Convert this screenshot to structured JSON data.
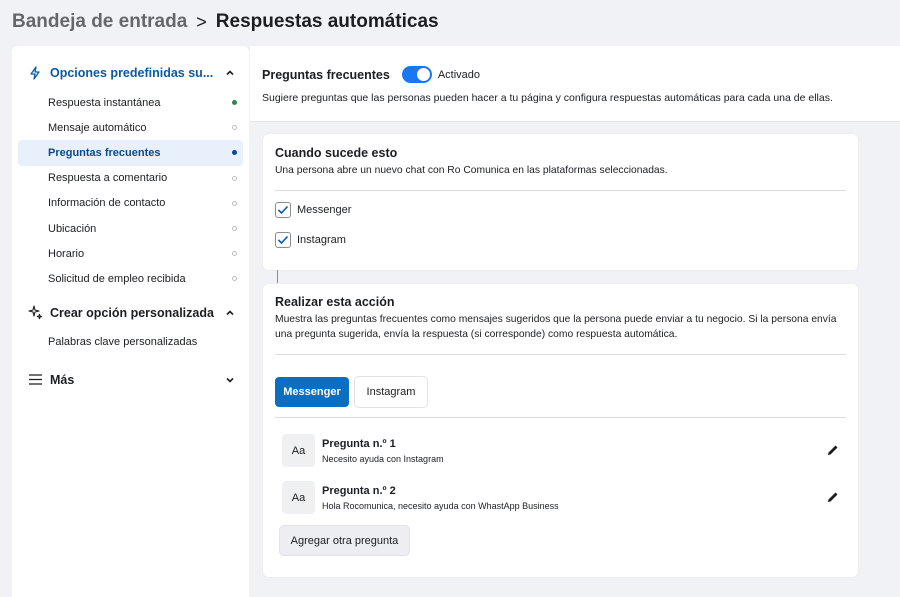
{
  "breadcrumb": {
    "parent": "Bandeja de entrada",
    "separator": ">",
    "current": "Respuestas automáticas"
  },
  "sidebar": {
    "section1": {
      "label": "Opciones predefinidas su...",
      "icon": "lightning-icon",
      "items": [
        {
          "label": "Respuesta instantánea",
          "status": "on"
        },
        {
          "label": "Mensaje automático",
          "status": "off"
        },
        {
          "label": "Preguntas frecuentes",
          "status": "on",
          "selected": true
        },
        {
          "label": "Respuesta a comentario",
          "status": "off"
        },
        {
          "label": "Información de contacto",
          "status": "off"
        },
        {
          "label": "Ubicación",
          "status": "off"
        },
        {
          "label": "Horario",
          "status": "off"
        },
        {
          "label": "Solicitud de empleo recibida",
          "status": "off"
        }
      ]
    },
    "section2": {
      "label": "Crear opción personalizada",
      "icon": "sparkle-icon",
      "items": [
        {
          "label": "Palabras clave personalizadas"
        }
      ]
    },
    "section3": {
      "label": "Más",
      "icon": "menu-icon"
    }
  },
  "main": {
    "title": "Preguntas frecuentes",
    "toggle_state": "Activado",
    "description": "Sugiere preguntas que las personas pueden hacer a tu página y configura respuestas automáticas para cada una de ellas.",
    "trigger": {
      "title": "Cuando sucede esto",
      "subtitle": "Una persona abre un nuevo chat con Ro Comunica en las plataformas seleccionadas.",
      "platforms": [
        {
          "label": "Messenger",
          "checked": true
        },
        {
          "label": "Instagram",
          "checked": true
        }
      ]
    },
    "action": {
      "title": "Realizar esta acción",
      "subtitle_line1": "Muestra las preguntas frecuentes como mensajes sugeridos que la persona puede enviar a tu negocio. Si la persona envía",
      "subtitle_line2": "una pregunta sugerida, envía la respuesta (si corresponde) como respuesta automática.",
      "tabs": [
        "Messenger",
        "Instagram"
      ],
      "active_tab": "Messenger",
      "questions": [
        {
          "avatar": "Aa",
          "title": "Pregunta n.º 1",
          "text": "Necesito ayuda con Instagram"
        },
        {
          "avatar": "Aa",
          "title": "Pregunta n.º 2",
          "text": "Hola Rocomunica, necesito ayuda con WhastApp Business"
        }
      ],
      "add_button": "Agregar otra pregunta"
    }
  },
  "colors": {
    "accent": "#1877f2",
    "selected_bg": "#e7f0fb",
    "selected_text": "#0a4a8c",
    "active_tab": "#0a6fc2"
  }
}
